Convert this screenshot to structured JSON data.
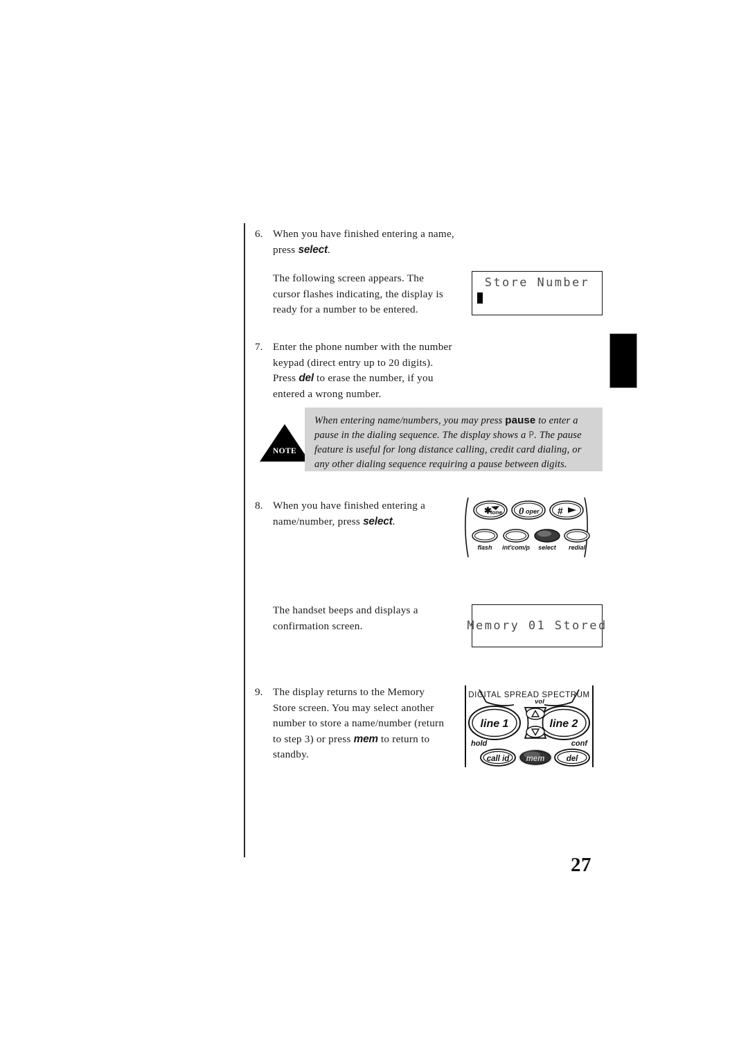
{
  "page": {
    "number": "27"
  },
  "steps": [
    {
      "num": "6.",
      "text_before": "When you have finished entering a name, press ",
      "keyword": "select",
      "text_after": "."
    },
    {
      "num": "7.",
      "text_before": "Enter the phone number with the number keypad (direct entry up to 20 digits). Press ",
      "keyword": "del",
      "text_after": " to erase the number, if you entered a wrong number."
    },
    {
      "num": "8.",
      "text_before": "When you have finished entering a name/number, press ",
      "keyword": "select",
      "text_after": "."
    },
    {
      "num": "9.",
      "text_before": "The display returns to the Memory Store screen. You may select another number to store a name/number (return to step 3) or press ",
      "keyword": "mem",
      "text_after": " to return to standby."
    }
  ],
  "paragraphs": {
    "screen_appears": "The following screen appears. The cursor flashes indicating, the display is ready for a number to be entered.",
    "handset_beeps": "The handset beeps and  displays a confirmation screen."
  },
  "lcd_displays": [
    {
      "id": "store-number",
      "line1": "Store Number",
      "line2": "",
      "cursor": true
    },
    {
      "id": "memory-stored",
      "line1": "Memory 01 Stored",
      "cursor": false
    }
  ],
  "note": {
    "badge_label": "NOTE",
    "text_part1": "When entering name/numbers, you may press ",
    "keyword1": "pause",
    "text_part2": " to enter a pause in the dialing sequence. The display shows a ",
    "pause_glyph": "P",
    "text_part3": ". The pause feature is useful for long distance calling, credit card dialing, or any other dialing sequence requiring a pause between digits.",
    "background_color": "#d3d3d3"
  },
  "keypad_illustration": {
    "top_row": [
      {
        "glyph": "✳",
        "label": "tone",
        "arrow": "left"
      },
      {
        "glyph": "0",
        "label": "oper",
        "arrow": "none"
      },
      {
        "glyph": "#",
        "label": "",
        "arrow": "right"
      }
    ],
    "bottom_row": [
      {
        "label": "flash",
        "highlighted": false
      },
      {
        "label": "int'com/p",
        "highlighted": false
      },
      {
        "label": "select",
        "highlighted": true
      },
      {
        "label": "redial",
        "highlighted": false
      }
    ]
  },
  "base_illustration": {
    "brand_text": "DIGITAL SPREAD SPECTRUM",
    "line_buttons": [
      "line 1",
      "line 2"
    ],
    "volume_label": "vol",
    "volume_up_glyph": "△",
    "volume_down_glyph": "▽",
    "side_labels": {
      "left": "hold",
      "right": "conf"
    },
    "bottom_buttons": [
      {
        "label": "call id",
        "highlighted": false
      },
      {
        "label": "mem",
        "highlighted": true
      },
      {
        "label": "del",
        "highlighted": false
      }
    ]
  },
  "colors": {
    "note_bg": "#d3d3d3",
    "ink": "#111111",
    "lcd_text": "#4a4a4a",
    "highlight_button": "#3a3a3a"
  }
}
